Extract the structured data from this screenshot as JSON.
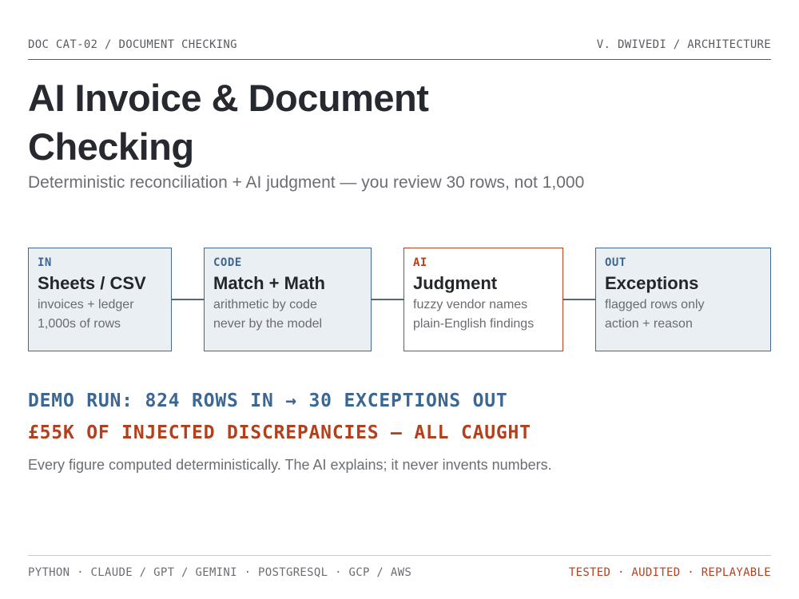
{
  "header": {
    "left": "DOC CAT-02 / DOCUMENT CHECKING",
    "right": "V. DWIVEDI / ARCHITECTURE"
  },
  "title": "AI Invoice & Document Checking",
  "subtitle": "Deterministic reconciliation + AI judgment — you review 30 rows, not 1,000",
  "flow": {
    "nodes": [
      {
        "tag": "IN",
        "title": "Sheets / CSV",
        "lines": [
          "invoices + ledger",
          "1,000s of rows"
        ]
      },
      {
        "tag": "CODE",
        "title": "Match + Math",
        "lines": [
          "arithmetic by code",
          "never by the model"
        ]
      },
      {
        "tag": "AI",
        "title": "Judgment",
        "lines": [
          "fuzzy vendor names",
          "plain-English findings"
        ]
      },
      {
        "tag": "OUT",
        "title": "Exceptions",
        "lines": [
          "flagged rows only",
          "action + reason"
        ]
      }
    ]
  },
  "stats": {
    "demo_run": "DEMO RUN: 824 ROWS IN → 30 EXCEPTIONS OUT",
    "caught": "£55K OF INJECTED DISCREPANCIES — ALL CAUGHT"
  },
  "note": "Every figure computed deterministically. The AI explains; it never invents numbers.",
  "footer": {
    "stack": "PYTHON · CLAUDE / GPT / GEMINI · POSTGRESQL · GCP / AWS",
    "qualities": "TESTED · AUDITED · REPLAYABLE"
  },
  "colors": {
    "accent_blue": "#3d6791",
    "accent_red": "#b9401d",
    "node_fill": "#eaeff4"
  }
}
